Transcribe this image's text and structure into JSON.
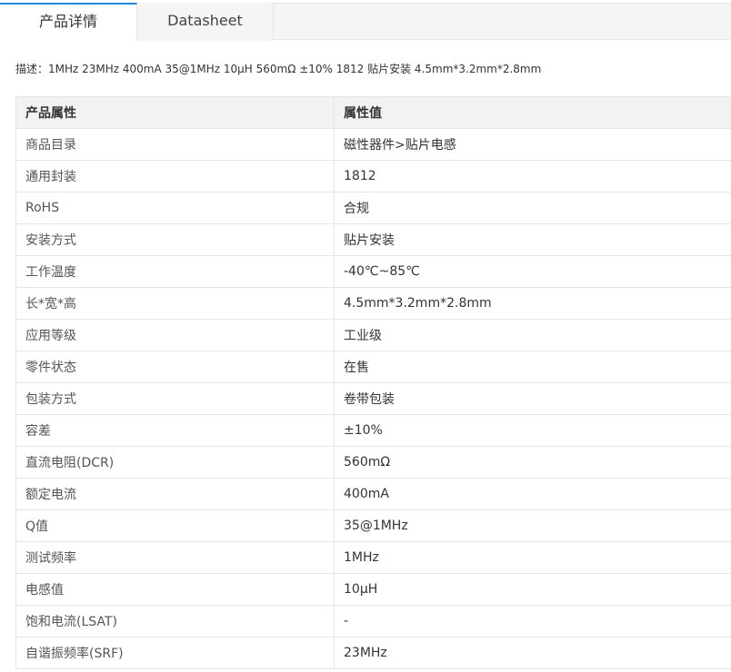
{
  "tabs": [
    {
      "label": "产品详情",
      "active": true
    },
    {
      "label": "Datasheet",
      "active": false
    }
  ],
  "description": "描述：1MHz 23MHz 400mA 35@1MHz 10µH 560mΩ ±10% 1812 贴片安装 4.5mm*3.2mm*2.8mm",
  "table": {
    "headers": [
      "产品属性",
      "属性值"
    ],
    "rows": [
      [
        "商品目录",
        "磁性器件>贴片电感"
      ],
      [
        "通用封装",
        "1812"
      ],
      [
        "RoHS",
        "合规"
      ],
      [
        "安装方式",
        "贴片安装"
      ],
      [
        "工作温度",
        "-40℃~85℃"
      ],
      [
        "长*宽*高",
        "4.5mm*3.2mm*2.8mm"
      ],
      [
        "应用等级",
        "工业级"
      ],
      [
        "零件状态",
        "在售"
      ],
      [
        "包装方式",
        "卷带包装"
      ],
      [
        "容差",
        "±10%"
      ],
      [
        "直流电阻(DCR)",
        "560mΩ"
      ],
      [
        "额定电流",
        "400mA"
      ],
      [
        "Q值",
        "35@1MHz"
      ],
      [
        "测试频率",
        "1MHz"
      ],
      [
        "电感值",
        "10µH"
      ],
      [
        "饱和电流(LSAT)",
        "-"
      ],
      [
        "自谐振频率(SRF)",
        "23MHz"
      ]
    ]
  },
  "colors": {
    "accent": "#1e88e5",
    "header_bg": "#f2f2f2",
    "border": "#e6e6e6",
    "tabbar_bg": "#f5f5f5"
  }
}
